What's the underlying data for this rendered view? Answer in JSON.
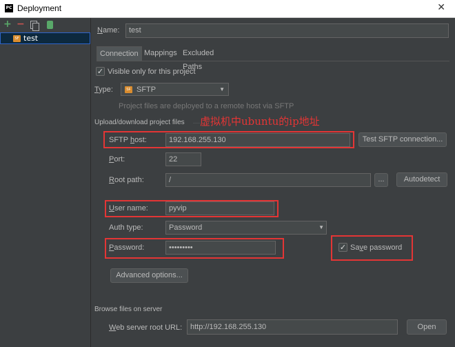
{
  "window": {
    "title": "Deployment",
    "app_icon": "pycharm-icon"
  },
  "left_panel": {
    "toolbar": {
      "add_icon": "plus-icon",
      "remove_icon": "minus-icon",
      "copy_icon": "copy-icon",
      "default_icon": "database-icon"
    },
    "servers": [
      {
        "label": "test",
        "icon": "sftp-server-icon"
      }
    ]
  },
  "name": {
    "label": "Name:",
    "value": "test"
  },
  "tabs": [
    {
      "label": "Connection",
      "active": true
    },
    {
      "label": "Mappings",
      "active": false
    },
    {
      "label": "Excluded Paths",
      "active": false
    }
  ],
  "visible_only": {
    "label": "Visible only for this project",
    "checked": true
  },
  "type": {
    "label": "Type:",
    "value": "SFTP",
    "hint": "Project files are deployed to a remote host via SFTP"
  },
  "upload_section": {
    "title": "Upload/download project files"
  },
  "annotation": {
    "text": "虚拟机中ubuntu的ip地址"
  },
  "sftp_host": {
    "label": "SFTP host:",
    "value": "192.168.255.130"
  },
  "test_button": {
    "label": "Test SFTP connection..."
  },
  "port": {
    "label": "Port:",
    "value": "22"
  },
  "root_path": {
    "label": "Root path:",
    "value": "/",
    "browse_label": "...",
    "autodetect_label": "Autodetect"
  },
  "user_name": {
    "label": "User name:",
    "value": "pyvip"
  },
  "auth_type": {
    "label": "Auth type:",
    "value": "Password"
  },
  "password": {
    "label": "Password:",
    "value": "•••••••••"
  },
  "save_password": {
    "label": "Save password",
    "checked": true
  },
  "advanced": {
    "label": "Advanced options..."
  },
  "browse_section": {
    "title": "Browse files on server"
  },
  "web_root": {
    "label": "Web server root URL:",
    "value": "http://192.168.255.130",
    "open_label": "Open"
  },
  "colors": {
    "annotation_red": "#e43535",
    "selection_blue": "#0d293e",
    "background": "#3c3f41"
  }
}
